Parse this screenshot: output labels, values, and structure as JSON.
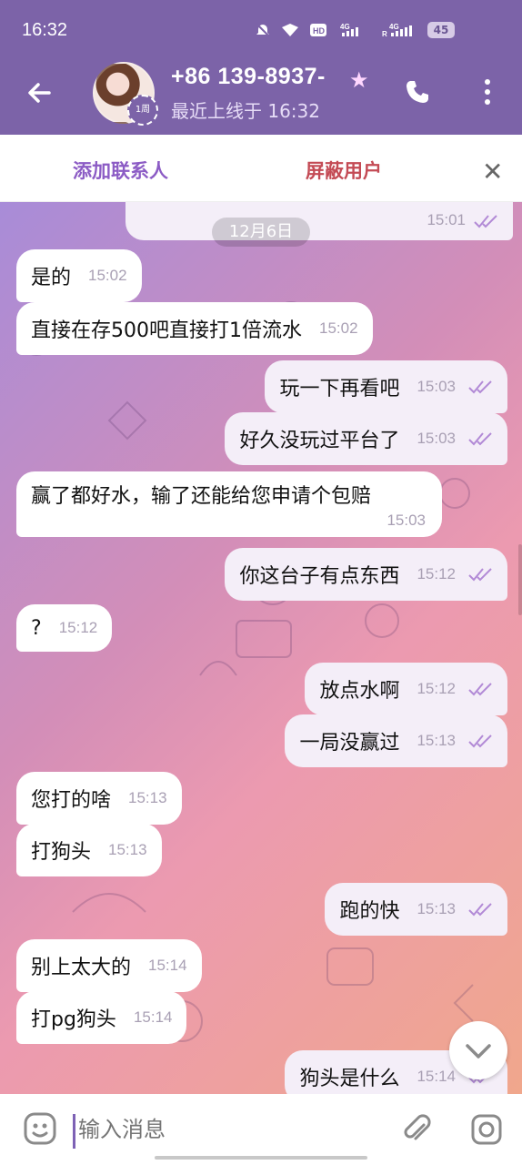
{
  "status_bar": {
    "time": "16:32",
    "icons": [
      "muted-icon",
      "wifi-icon",
      "hd-icon",
      "4g-signal-icon",
      "4g-signal-icon"
    ],
    "battery": "45"
  },
  "header": {
    "contact_name": "+86 139-8937-",
    "last_seen": "最近上线于 16:32",
    "avatar_badge": "1周"
  },
  "action_bar": {
    "add_contact": "添加联系人",
    "block_user": "屏蔽用户",
    "close": "✕"
  },
  "chat": {
    "date": "12月6日",
    "messages": [
      {
        "dir": "out",
        "text": "",
        "time": "15:01"
      },
      {
        "dir": "in",
        "text": "是的",
        "time": "15:02"
      },
      {
        "dir": "in",
        "text": "直接在存500吧直接打1倍流水",
        "time": "15:02"
      },
      {
        "dir": "out",
        "text": "玩一下再看吧",
        "time": "15:03"
      },
      {
        "dir": "out",
        "text": "好久没玩过平台了",
        "time": "15:03"
      },
      {
        "dir": "in",
        "text": "赢了都好水，输了还能给您申请个包赔",
        "time": "15:03"
      },
      {
        "dir": "out",
        "text": "你这台子有点东西",
        "time": "15:12"
      },
      {
        "dir": "in",
        "text": "?",
        "time": "15:12"
      },
      {
        "dir": "out",
        "text": "放点水啊",
        "time": "15:12"
      },
      {
        "dir": "out",
        "text": "一局没赢过",
        "time": "15:13"
      },
      {
        "dir": "in",
        "text": "您打的啥",
        "time": "15:13"
      },
      {
        "dir": "in",
        "text": "打狗头",
        "time": "15:13"
      },
      {
        "dir": "out",
        "text": "跑的快",
        "time": "15:13"
      },
      {
        "dir": "in",
        "text": "别上太大的",
        "time": "15:14"
      },
      {
        "dir": "in",
        "text": "打pg狗头",
        "time": "15:14"
      },
      {
        "dir": "out",
        "text": "狗头是什么",
        "time": "15:14"
      }
    ]
  },
  "composer": {
    "placeholder": "输入消息"
  }
}
